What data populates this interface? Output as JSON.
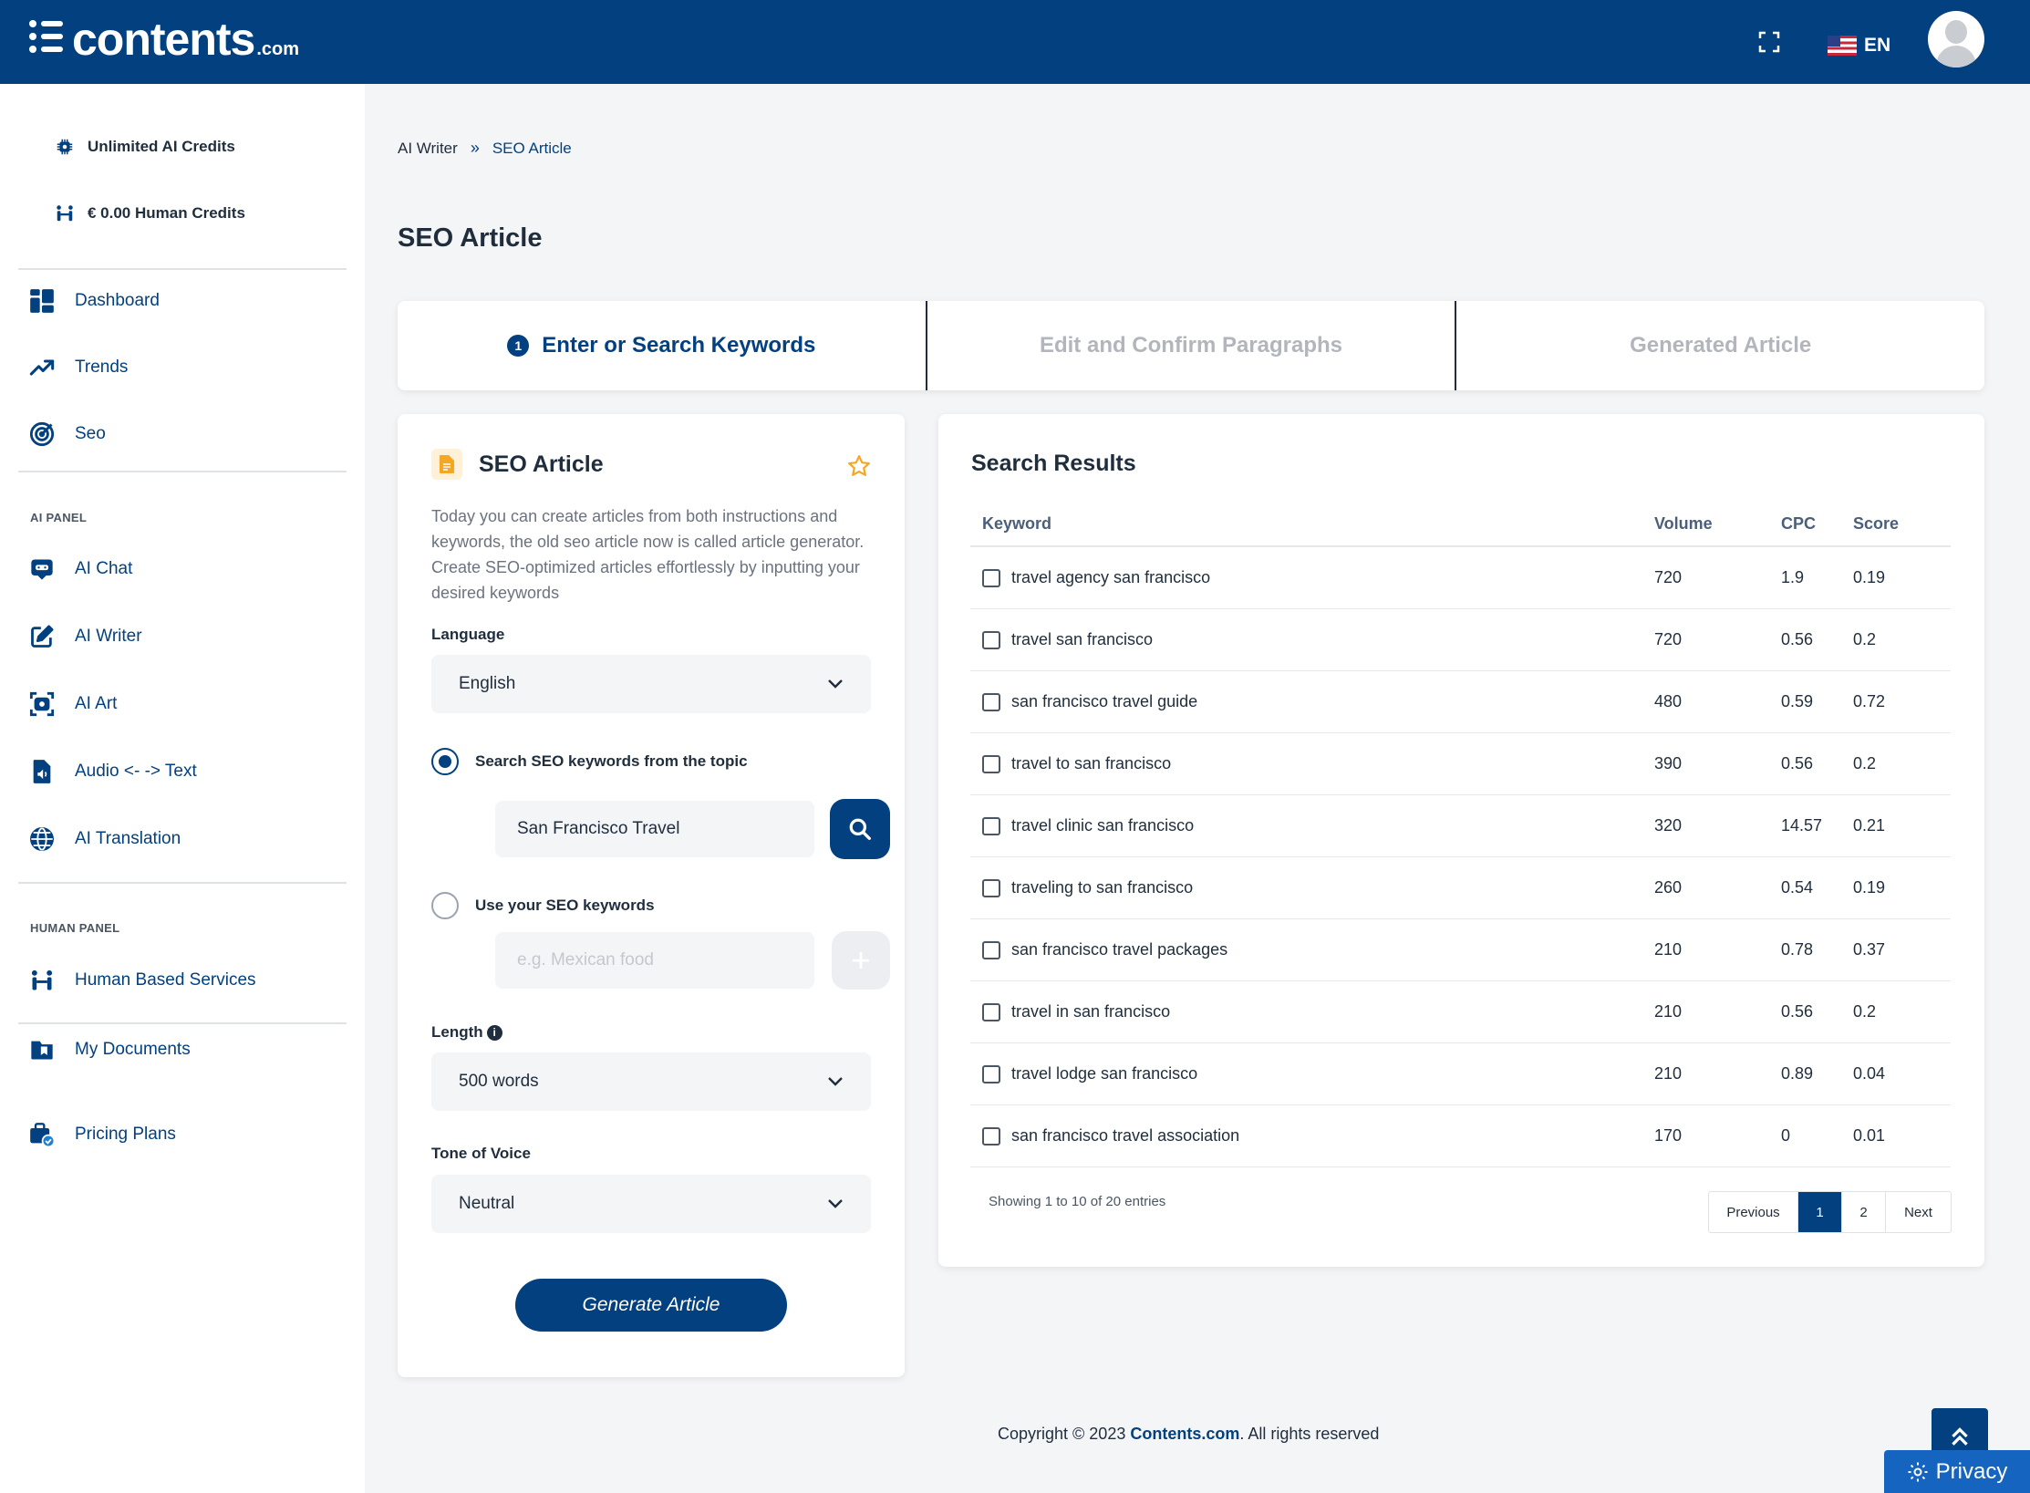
{
  "header": {
    "logo_text": "contents",
    "logo_suffix": ".com",
    "language": "EN",
    "icons": [
      "fullscreen-icon",
      "us-flag-icon",
      "user-avatar"
    ],
    "brand_color": "#03407f"
  },
  "sidebar": {
    "credits": [
      {
        "label": "Unlimited AI Credits",
        "icon": "chip-icon"
      },
      {
        "label": "€ 0.00 Human Credits",
        "icon": "people-icon"
      }
    ],
    "main_items": [
      {
        "label": "Dashboard",
        "icon": "dashboard-icon"
      },
      {
        "label": "Trends",
        "icon": "trend-icon"
      },
      {
        "label": "Seo",
        "icon": "target-icon"
      }
    ],
    "ai_panel_label": "AI PANEL",
    "ai_items": [
      {
        "label": "AI Chat",
        "icon": "chat-icon"
      },
      {
        "label": "AI Writer",
        "icon": "edit-icon"
      },
      {
        "label": "AI Art",
        "icon": "camera-icon"
      },
      {
        "label": "Audio <- -> Text",
        "icon": "audio-file-icon"
      },
      {
        "label": "AI Translation",
        "icon": "globe-icon"
      }
    ],
    "human_panel_label": "HUMAN PANEL",
    "human_items": [
      {
        "label": "Human Based Services",
        "icon": "people-icon"
      }
    ],
    "bottom_items": [
      {
        "label": "My Documents",
        "icon": "folder-icon"
      },
      {
        "label": "Pricing Plans",
        "icon": "pricing-icon"
      }
    ]
  },
  "breadcrumb": {
    "first": "AI Writer",
    "separator": "»",
    "current": "SEO Article"
  },
  "page_title": "SEO Article",
  "steps": [
    {
      "number": "1",
      "label": "Enter or Search Keywords",
      "active": true
    },
    {
      "label": "Edit and Confirm Paragraphs",
      "active": false
    },
    {
      "label": "Generated Article",
      "active": false
    }
  ],
  "form": {
    "title": "SEO Article",
    "description": "Today you can create articles from both instructions and keywords, the old seo article now is called article generator. Create SEO-optimized articles effortlessly by inputting your desired keywords",
    "language_label": "Language",
    "language_value": "English",
    "radio_search_label": "Search SEO keywords from the topic",
    "search_value": "San Francisco Travel",
    "radio_own_label": "Use your SEO keywords",
    "own_placeholder": "e.g. Mexican food",
    "length_label": "Length",
    "length_value": "500 words",
    "tone_label": "Tone of Voice",
    "tone_value": "Neutral",
    "generate_label": "Generate Article"
  },
  "results": {
    "title": "Search Results",
    "columns": {
      "keyword": "Keyword",
      "volume": "Volume",
      "cpc": "CPC",
      "score": "Score"
    },
    "rows": [
      {
        "keyword": "travel agency san francisco",
        "volume": "720",
        "cpc": "1.9",
        "score": "0.19"
      },
      {
        "keyword": "travel san francisco",
        "volume": "720",
        "cpc": "0.56",
        "score": "0.2"
      },
      {
        "keyword": "san francisco travel guide",
        "volume": "480",
        "cpc": "0.59",
        "score": "0.72"
      },
      {
        "keyword": "travel to san francisco",
        "volume": "390",
        "cpc": "0.56",
        "score": "0.2"
      },
      {
        "keyword": "travel clinic san francisco",
        "volume": "320",
        "cpc": "14.57",
        "score": "0.21"
      },
      {
        "keyword": "traveling to san francisco",
        "volume": "260",
        "cpc": "0.54",
        "score": "0.19"
      },
      {
        "keyword": "san francisco travel packages",
        "volume": "210",
        "cpc": "0.78",
        "score": "0.37"
      },
      {
        "keyword": "travel in san francisco",
        "volume": "210",
        "cpc": "0.56",
        "score": "0.2"
      },
      {
        "keyword": "travel lodge san francisco",
        "volume": "210",
        "cpc": "0.89",
        "score": "0.04"
      },
      {
        "keyword": "san francisco travel association",
        "volume": "170",
        "cpc": "0",
        "score": "0.01"
      }
    ],
    "entries_info": "Showing 1 to 10 of 20 entries",
    "pagination": {
      "previous": "Previous",
      "pages": [
        "1",
        "2"
      ],
      "current": "1",
      "next": "Next"
    }
  },
  "footer": {
    "prefix": "Copyright © 2023 ",
    "brand": "Contents.com",
    "suffix": ". All rights reserved"
  },
  "privacy_label": "Privacy"
}
